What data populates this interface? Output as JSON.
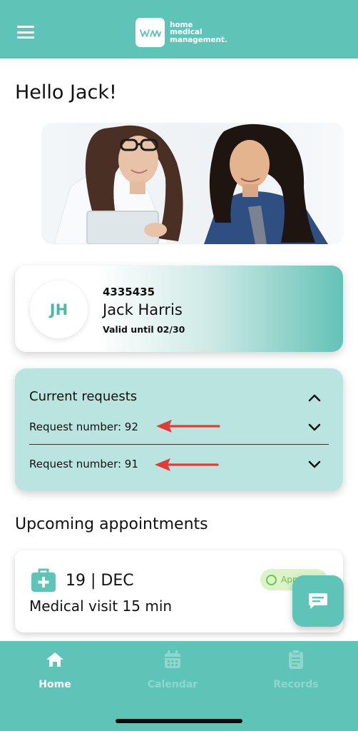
{
  "colors": {
    "brand": "#5fc4b8",
    "request_panel": "#b9e4df",
    "status_green": "#6cc35a",
    "arrow_red": "#e53935"
  },
  "header": {
    "menu_icon": "hamburger-menu-icon",
    "logo": {
      "line1": "home",
      "line2": "medical",
      "line3": "management."
    }
  },
  "greeting": "Hello Jack!",
  "patient": {
    "initials": "JH",
    "id": "4335435",
    "name": "Jack Harris",
    "valid": "Valid until 02/30"
  },
  "requests": {
    "title": "Current requests",
    "items": [
      {
        "label": "Request number: 92"
      },
      {
        "label": "Request number: 91"
      }
    ]
  },
  "appointments": {
    "title": "Upcoming appointments",
    "items": [
      {
        "date": "19 | DEC",
        "description": "Medical visit 15 min",
        "status": "Approved",
        "icon": "medical-kit-icon"
      }
    ]
  },
  "fab": {
    "icon": "chat-icon"
  },
  "nav": {
    "items": [
      {
        "label": "Home",
        "icon": "home-icon",
        "active": true
      },
      {
        "label": "Calendar",
        "icon": "calendar-icon",
        "active": false
      },
      {
        "label": "Records",
        "icon": "clipboard-icon",
        "active": false
      }
    ]
  }
}
